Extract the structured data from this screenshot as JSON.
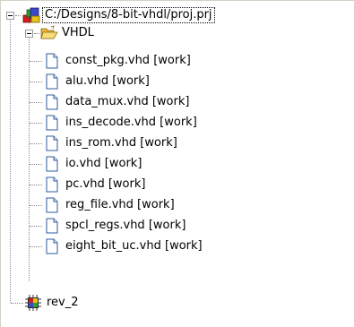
{
  "project": {
    "path": "C:/Designs/8-bit-vhdl/proj.prj",
    "icon": "project-icon"
  },
  "folder": {
    "label": "VHDL",
    "icon": "open-folder-icon"
  },
  "files": [
    {
      "label": "const_pkg.vhd [work]",
      "icon": "file-icon"
    },
    {
      "label": "alu.vhd [work]",
      "icon": "file-icon"
    },
    {
      "label": "data_mux.vhd [work]",
      "icon": "file-icon"
    },
    {
      "label": "ins_decode.vhd [work]",
      "icon": "file-icon"
    },
    {
      "label": "ins_rom.vhd [work]",
      "icon": "file-icon"
    },
    {
      "label": "io.vhd [work]",
      "icon": "file-icon"
    },
    {
      "label": "pc.vhd [work]",
      "icon": "file-icon"
    },
    {
      "label": "reg_file.vhd [work]",
      "icon": "file-icon"
    },
    {
      "label": "spcl_regs.vhd [work]",
      "icon": "file-icon"
    },
    {
      "label": "eight_bit_uc.vhd [work]",
      "icon": "file-icon"
    }
  ],
  "implementation": {
    "label": "rev_2",
    "icon": "chip-icon"
  },
  "colors": {
    "selection_outline": "#000000",
    "tree_lines": "#8a8a8a",
    "folder": "#f5d76e",
    "file": "#5a7fb5"
  }
}
